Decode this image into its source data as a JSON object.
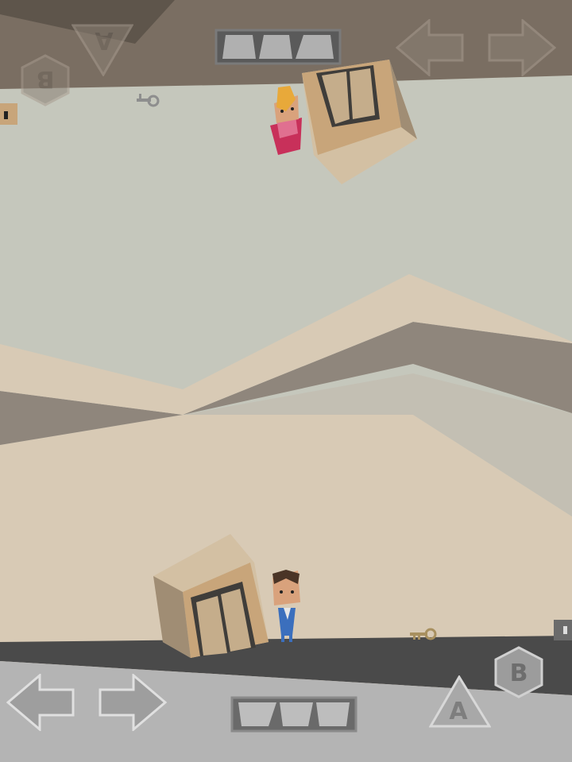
{
  "colors": {
    "sky": "#c5c7bc",
    "ceiling": "#7a6e62",
    "ceiling_dark": "#5e554b",
    "floor_strip": "#4a4a4a",
    "floor_hud": "#b4b4b4",
    "sand": "#d8cab5",
    "mountain_mid": "#8f867c",
    "mountain_light": "#c3bfb3",
    "crate_front": "#c8a57a",
    "crate_side": "#a08d74",
    "crate_top": "#d3c0a3",
    "door_frame": "#3f3d3a",
    "door_panel": "#c5ad8b",
    "player_skin": "#d9a27c",
    "player_hair": "#4a3426",
    "player_shirt": "#3b6fbd",
    "girl_hair": "#e8a93a",
    "girl_dress": "#c8305a"
  },
  "hud_bottom": {
    "left_arrow": "arrow-left",
    "right_arrow": "arrow-right",
    "inventory_slots": 3,
    "a_button": "A",
    "b_button": "B"
  },
  "hud_top_mirrored": {
    "left_arrow": "arrow-left",
    "right_arrow": "arrow-right",
    "inventory_slots": 3,
    "a_button": "A",
    "b_button": "B"
  },
  "items": {
    "key_bottom": "key-icon",
    "key_top": "key-icon",
    "lock_bottom": "padlock-icon",
    "lock_top": "padlock-icon"
  }
}
